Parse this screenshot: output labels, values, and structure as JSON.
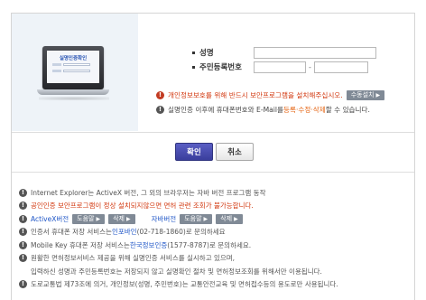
{
  "illustration": {
    "screen_title": "실명인증확인"
  },
  "form": {
    "name_label": "성명",
    "rrn_label": "주민등록번호",
    "rrn_separator": "-"
  },
  "notices": {
    "security_text": "개인정보보호를 위해 반드시 보안프로그램을 설치해주십시오.",
    "manual_install_button": "수동설치",
    "after_auth_prefix": "실명인증 이후에 휴대폰번호와 E-Mail를 ",
    "after_auth_highlight": "등록·수정·삭제",
    "after_auth_suffix": "할 수 있습니다."
  },
  "buttons": {
    "confirm": "확인",
    "cancel": "취소"
  },
  "info": {
    "ie_line": "Internet Explorer는 ActiveX 버전, 그 외의 브라우저는 자바 버전 프로그램 동작",
    "warning_line": "공인인증 보안프로그램이 정상 설치되지않으면 면허 관련 조회가 불가능합니다.",
    "activex_label": "ActiveX버전",
    "help_button_1": "도움말",
    "delete_button_1": "삭제",
    "java_label": "자바버전",
    "help_button_2": "도움말",
    "delete_button_2": "삭제",
    "cert_prefix": "인증서 휴대폰 저장 서비스는 ",
    "cert_link": "인포바인",
    "cert_suffix": "(02-718-1860)로 문의하세요",
    "mobilekey_prefix": "Mobile Key 휴대폰 저장 서비스는 ",
    "mobilekey_link": "한국정보인증",
    "mobilekey_suffix": "(1577-8787)로 문의하세요.",
    "service_line_1": "원활한 면허정보서비스 제공을 위해 실명인증 서비스를 실시하고 있으며,",
    "service_line_2": "입력하신 성명과 주민등록번호는 저장되지 않고 실명확인 절차 및 면허정보조회를 위해서만 이용됩니다.",
    "law_line": "도로교통법 제73조에 의거, 개인정보(성명, 주민번호)는 교통안전교육 및 면허접수등의 용도로만 사용됩니다."
  },
  "colors": {
    "accent_red": "#d2370e",
    "link_blue": "#1f56c7",
    "confirm_button": "#4a4eb4"
  },
  "icons": {
    "warning": "exclamation-circle-icon",
    "arrow": "right-triangle-icon"
  }
}
